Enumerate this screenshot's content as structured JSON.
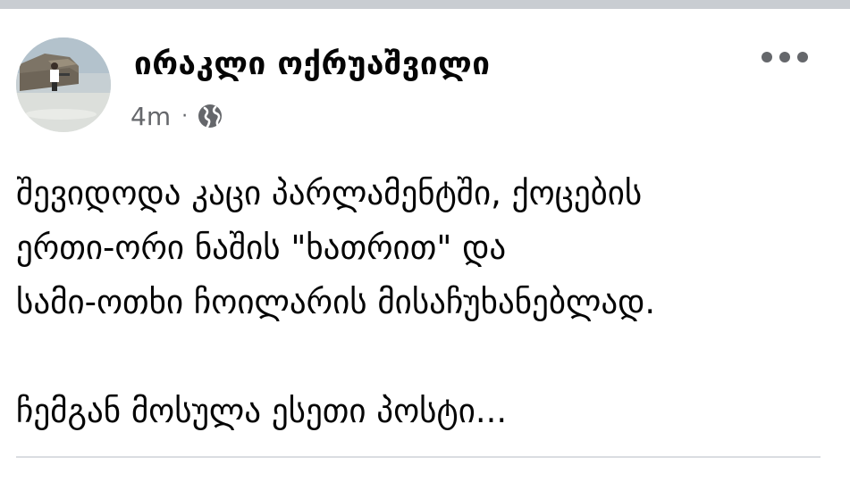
{
  "post": {
    "author_name": "ირაკლი ოქრუაშვილი",
    "timestamp": "4m",
    "separator": "·",
    "privacy_icon": "globe-icon",
    "more_icon": "more-horizontal-icon",
    "body_lines": [
      "შევიდოდა კაცი პარლამენტში, ქოცების",
      "ერთი-ორი ნაშის \"ხათრით\" და",
      "სამი-ოთხი ჩოილარის მისაჩუხანებლად.",
      "ჩემგან მოსულა ესეთი პოსტი..."
    ]
  },
  "colors": {
    "name_text": "#050505",
    "meta_text": "#65676b",
    "divider": "#dadde1",
    "top_strip": "#c9cdd2"
  }
}
